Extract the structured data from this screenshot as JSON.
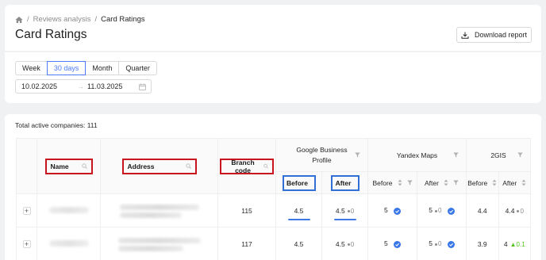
{
  "breadcrumb": {
    "items": [
      "Reviews analysis",
      "Card Ratings"
    ]
  },
  "page": {
    "title": "Card Ratings"
  },
  "actions": {
    "download_label": "Download report"
  },
  "filters": {
    "periods": [
      "Week",
      "30 days",
      "Month",
      "Quarter"
    ],
    "active_period": "30 days",
    "date_start": "10.02.2025",
    "date_end": "11.03.2025",
    "date_separator": "→"
  },
  "summary": {
    "total_label": "Total active companies: 111"
  },
  "table": {
    "headers": {
      "name": "Name",
      "address": "Address",
      "branch_code": "Branch code",
      "google": "Google Business Profile",
      "yandex": "Yandex Maps",
      "gis": "2GIS",
      "before": "Before",
      "after": "After"
    },
    "rows": [
      {
        "branch_code": "115",
        "google_before": "4.5",
        "google_after": "4.5",
        "google_delta": "0",
        "yandex_before": "5",
        "yandex_after": "5",
        "yandex_delta": "0",
        "gis_before": "4.4",
        "gis_after": "4.4",
        "gis_delta": "0"
      },
      {
        "branch_code": "117",
        "google_before": "4.5",
        "google_after": "4.5",
        "google_delta": "0",
        "yandex_before": "5",
        "yandex_after": "5",
        "yandex_delta": "0",
        "gis_before": "3.9",
        "gis_after": "4",
        "gis_delta": "0.1"
      }
    ]
  },
  "colors": {
    "accent": "#4d7cf6",
    "highlight_red": "#c8141c",
    "highlight_blue": "#2f6fd6",
    "positive": "#52c41a"
  }
}
